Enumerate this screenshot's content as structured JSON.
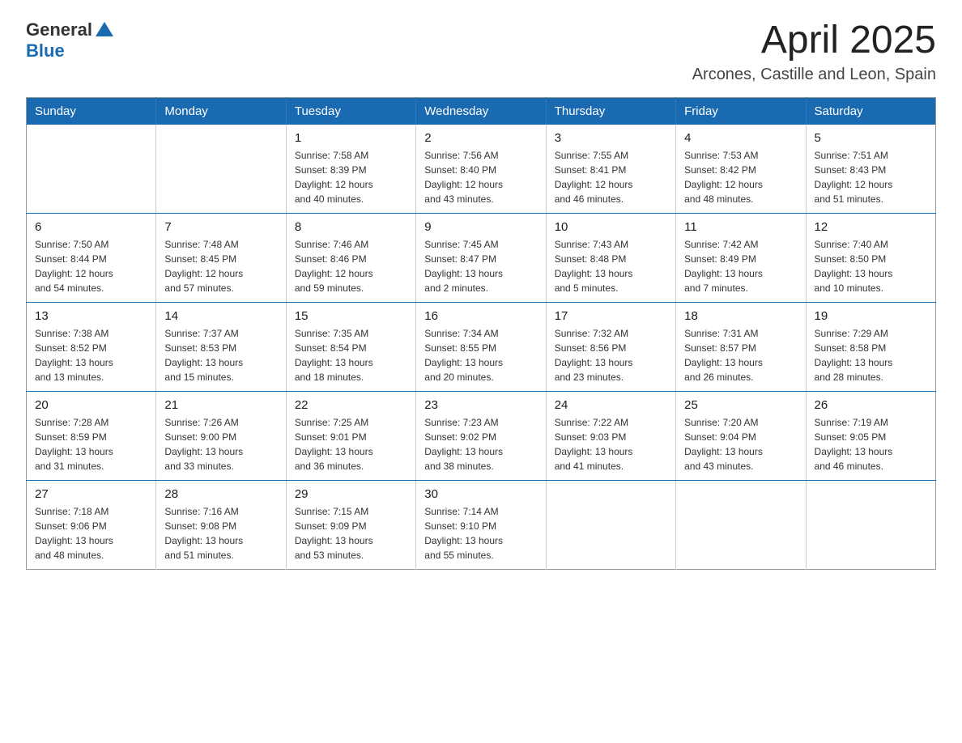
{
  "header": {
    "logo_general": "General",
    "logo_arrow": "▲",
    "logo_blue": "Blue",
    "month_title": "April 2025",
    "location": "Arcones, Castille and Leon, Spain"
  },
  "weekdays": [
    "Sunday",
    "Monday",
    "Tuesday",
    "Wednesday",
    "Thursday",
    "Friday",
    "Saturday"
  ],
  "weeks": [
    [
      {
        "day": "",
        "info": ""
      },
      {
        "day": "",
        "info": ""
      },
      {
        "day": "1",
        "info": "Sunrise: 7:58 AM\nSunset: 8:39 PM\nDaylight: 12 hours\nand 40 minutes."
      },
      {
        "day": "2",
        "info": "Sunrise: 7:56 AM\nSunset: 8:40 PM\nDaylight: 12 hours\nand 43 minutes."
      },
      {
        "day": "3",
        "info": "Sunrise: 7:55 AM\nSunset: 8:41 PM\nDaylight: 12 hours\nand 46 minutes."
      },
      {
        "day": "4",
        "info": "Sunrise: 7:53 AM\nSunset: 8:42 PM\nDaylight: 12 hours\nand 48 minutes."
      },
      {
        "day": "5",
        "info": "Sunrise: 7:51 AM\nSunset: 8:43 PM\nDaylight: 12 hours\nand 51 minutes."
      }
    ],
    [
      {
        "day": "6",
        "info": "Sunrise: 7:50 AM\nSunset: 8:44 PM\nDaylight: 12 hours\nand 54 minutes."
      },
      {
        "day": "7",
        "info": "Sunrise: 7:48 AM\nSunset: 8:45 PM\nDaylight: 12 hours\nand 57 minutes."
      },
      {
        "day": "8",
        "info": "Sunrise: 7:46 AM\nSunset: 8:46 PM\nDaylight: 12 hours\nand 59 minutes."
      },
      {
        "day": "9",
        "info": "Sunrise: 7:45 AM\nSunset: 8:47 PM\nDaylight: 13 hours\nand 2 minutes."
      },
      {
        "day": "10",
        "info": "Sunrise: 7:43 AM\nSunset: 8:48 PM\nDaylight: 13 hours\nand 5 minutes."
      },
      {
        "day": "11",
        "info": "Sunrise: 7:42 AM\nSunset: 8:49 PM\nDaylight: 13 hours\nand 7 minutes."
      },
      {
        "day": "12",
        "info": "Sunrise: 7:40 AM\nSunset: 8:50 PM\nDaylight: 13 hours\nand 10 minutes."
      }
    ],
    [
      {
        "day": "13",
        "info": "Sunrise: 7:38 AM\nSunset: 8:52 PM\nDaylight: 13 hours\nand 13 minutes."
      },
      {
        "day": "14",
        "info": "Sunrise: 7:37 AM\nSunset: 8:53 PM\nDaylight: 13 hours\nand 15 minutes."
      },
      {
        "day": "15",
        "info": "Sunrise: 7:35 AM\nSunset: 8:54 PM\nDaylight: 13 hours\nand 18 minutes."
      },
      {
        "day": "16",
        "info": "Sunrise: 7:34 AM\nSunset: 8:55 PM\nDaylight: 13 hours\nand 20 minutes."
      },
      {
        "day": "17",
        "info": "Sunrise: 7:32 AM\nSunset: 8:56 PM\nDaylight: 13 hours\nand 23 minutes."
      },
      {
        "day": "18",
        "info": "Sunrise: 7:31 AM\nSunset: 8:57 PM\nDaylight: 13 hours\nand 26 minutes."
      },
      {
        "day": "19",
        "info": "Sunrise: 7:29 AM\nSunset: 8:58 PM\nDaylight: 13 hours\nand 28 minutes."
      }
    ],
    [
      {
        "day": "20",
        "info": "Sunrise: 7:28 AM\nSunset: 8:59 PM\nDaylight: 13 hours\nand 31 minutes."
      },
      {
        "day": "21",
        "info": "Sunrise: 7:26 AM\nSunset: 9:00 PM\nDaylight: 13 hours\nand 33 minutes."
      },
      {
        "day": "22",
        "info": "Sunrise: 7:25 AM\nSunset: 9:01 PM\nDaylight: 13 hours\nand 36 minutes."
      },
      {
        "day": "23",
        "info": "Sunrise: 7:23 AM\nSunset: 9:02 PM\nDaylight: 13 hours\nand 38 minutes."
      },
      {
        "day": "24",
        "info": "Sunrise: 7:22 AM\nSunset: 9:03 PM\nDaylight: 13 hours\nand 41 minutes."
      },
      {
        "day": "25",
        "info": "Sunrise: 7:20 AM\nSunset: 9:04 PM\nDaylight: 13 hours\nand 43 minutes."
      },
      {
        "day": "26",
        "info": "Sunrise: 7:19 AM\nSunset: 9:05 PM\nDaylight: 13 hours\nand 46 minutes."
      }
    ],
    [
      {
        "day": "27",
        "info": "Sunrise: 7:18 AM\nSunset: 9:06 PM\nDaylight: 13 hours\nand 48 minutes."
      },
      {
        "day": "28",
        "info": "Sunrise: 7:16 AM\nSunset: 9:08 PM\nDaylight: 13 hours\nand 51 minutes."
      },
      {
        "day": "29",
        "info": "Sunrise: 7:15 AM\nSunset: 9:09 PM\nDaylight: 13 hours\nand 53 minutes."
      },
      {
        "day": "30",
        "info": "Sunrise: 7:14 AM\nSunset: 9:10 PM\nDaylight: 13 hours\nand 55 minutes."
      },
      {
        "day": "",
        "info": ""
      },
      {
        "day": "",
        "info": ""
      },
      {
        "day": "",
        "info": ""
      }
    ]
  ]
}
